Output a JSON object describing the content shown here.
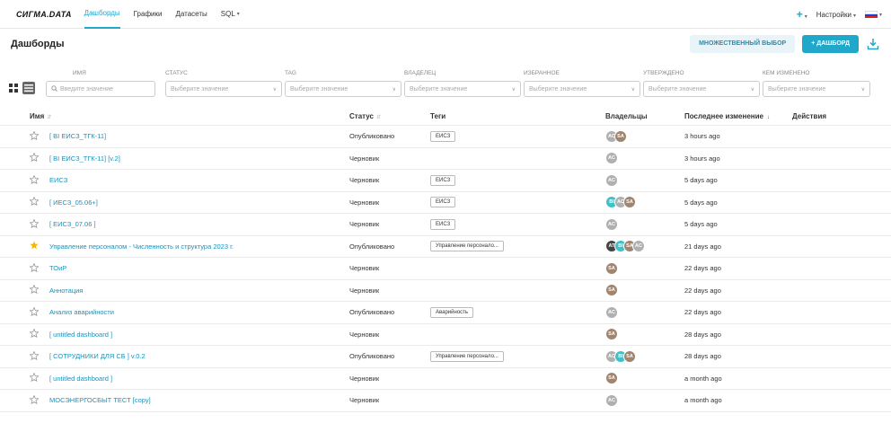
{
  "nav": {
    "brand": "СИГМА.DATA",
    "links": [
      "Дашборды",
      "Графики",
      "Датасеты",
      "SQL"
    ],
    "sql_caret": "▾",
    "plus": "+",
    "settings": "Настройки"
  },
  "header": {
    "title": "Дашборды",
    "multi_select": "МНОЖЕСТВЕННЫЙ ВЫБОР",
    "add_dashboard": "+ ДАШБОРД"
  },
  "filters": [
    {
      "label": "ИМЯ",
      "placeholder": "Введите значение"
    },
    {
      "label": "СТАТУС",
      "placeholder": "Выберите значение"
    },
    {
      "label": "TAG",
      "placeholder": "Выберите значение"
    },
    {
      "label": "ВЛАДЕЛЕЦ",
      "placeholder": "Выберите значение"
    },
    {
      "label": "ИЗБРАННОЕ",
      "placeholder": "Выберите значение"
    },
    {
      "label": "УТВЕРЖДЕНО",
      "placeholder": "Выберите значение"
    },
    {
      "label": "КЕМ ИЗМЕНЕНО",
      "placeholder": "Выберите значение"
    }
  ],
  "table": {
    "headers": {
      "name": "Имя",
      "status": "Статус",
      "tags": "Теги",
      "owners": "Владельцы",
      "modified": "Последнее изменение",
      "actions": "Действия"
    },
    "rows": [
      {
        "name": "[ BI ЕИСЗ_ТГК-11]",
        "status": "Опубликовано",
        "tag": "ЕИСЗ",
        "owners": [
          {
            "i": "AC",
            "c": "#b0b0b0"
          },
          {
            "i": "SA",
            "c": "#a08570"
          }
        ],
        "modified": "3 hours ago",
        "fav": false
      },
      {
        "name": "[ BI ЕИСЗ_ТГК-11] [v.2]",
        "status": "Черновик",
        "tag": "",
        "owners": [
          {
            "i": "AC",
            "c": "#b0b0b0"
          }
        ],
        "modified": "3 hours ago",
        "fav": false
      },
      {
        "name": "ЕИСЗ",
        "status": "Черновик",
        "tag": "ЕИСЗ",
        "owners": [
          {
            "i": "AC",
            "c": "#b0b0b0"
          }
        ],
        "modified": "5 days ago",
        "fav": false
      },
      {
        "name": "[ ИЕСЗ_05.06+]",
        "status": "Черновик",
        "tag": "ЕИСЗ",
        "owners": [
          {
            "i": "BI",
            "c": "#3fc1c9"
          },
          {
            "i": "AC",
            "c": "#b0b0b0"
          },
          {
            "i": "SA",
            "c": "#a08570"
          }
        ],
        "modified": "5 days ago",
        "fav": false
      },
      {
        "name": "[ ЕИСЗ_07.06 ]",
        "status": "Черновик",
        "tag": "ЕИСЗ",
        "owners": [
          {
            "i": "AC",
            "c": "#b0b0b0"
          }
        ],
        "modified": "5 days ago",
        "fav": false
      },
      {
        "name": "Управление персоналом - Численность и структура 2023 г.",
        "status": "Опубликовано",
        "tag": "Управление персонало...",
        "owners": [
          {
            "i": "AT",
            "c": "#444"
          },
          {
            "i": "BI",
            "c": "#3fc1c9"
          },
          {
            "i": "SA",
            "c": "#a08570"
          },
          {
            "i": "AC",
            "c": "#b0b0b0"
          }
        ],
        "modified": "21 days ago",
        "fav": true
      },
      {
        "name": "ТОиР",
        "status": "Черновик",
        "tag": "",
        "owners": [
          {
            "i": "SA",
            "c": "#a08570"
          }
        ],
        "modified": "22 days ago",
        "fav": false
      },
      {
        "name": "Аннотация",
        "status": "Черновик",
        "tag": "",
        "owners": [
          {
            "i": "SA",
            "c": "#a08570"
          }
        ],
        "modified": "22 days ago",
        "fav": false
      },
      {
        "name": "Анализ аварийности",
        "status": "Опубликовано",
        "tag": "Аварийность",
        "owners": [
          {
            "i": "AC",
            "c": "#b0b0b0"
          }
        ],
        "modified": "22 days ago",
        "fav": false
      },
      {
        "name": "[ untitled dashboard ]",
        "status": "Черновик",
        "tag": "",
        "owners": [
          {
            "i": "SA",
            "c": "#a08570"
          }
        ],
        "modified": "28 days ago",
        "fav": false
      },
      {
        "name": "[ СОТРУДНИКИ ДЛЯ СБ ] v.0.2",
        "status": "Опубликовано",
        "tag": "Управление персонало...",
        "owners": [
          {
            "i": "AC",
            "c": "#b0b0b0"
          },
          {
            "i": "BI",
            "c": "#3fc1c9"
          },
          {
            "i": "SA",
            "c": "#a08570"
          }
        ],
        "modified": "28 days ago",
        "fav": false
      },
      {
        "name": "[ untitled dashboard ]",
        "status": "Черновик",
        "tag": "",
        "owners": [
          {
            "i": "SA",
            "c": "#a08570"
          }
        ],
        "modified": "a month ago",
        "fav": false
      },
      {
        "name": "МОСЭНЕРГОСБЫТ ТЕСТ [copy]",
        "status": "Черновик",
        "tag": "",
        "owners": [
          {
            "i": "AC",
            "c": "#b0b0b0"
          }
        ],
        "modified": "a month ago",
        "fav": false
      }
    ]
  },
  "colors": {
    "accent": "#20a7c9",
    "star_active": "#f7b500",
    "star_inactive": "#999"
  }
}
